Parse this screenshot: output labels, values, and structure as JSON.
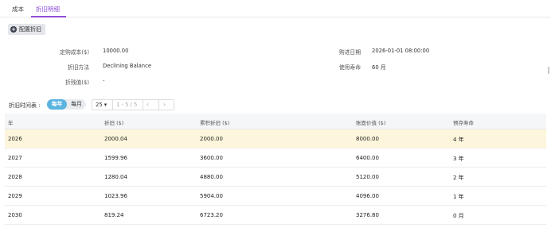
{
  "tabs": [
    {
      "label": "成本"
    },
    {
      "label": "折旧明细"
    }
  ],
  "config_button": {
    "label": "配置折旧",
    "icon": "plus-circle-icon"
  },
  "info": {
    "purchase_cost_label": "定购成本($)",
    "purchase_cost_value": "10000.00",
    "method_label": "折旧方法",
    "method_value": "Declining Balance",
    "residual_label": "折残值($)",
    "residual_value": "-",
    "purchase_date_label": "购进日期",
    "purchase_date_value": "2026-01-01 08:00:00",
    "lifespan_label": "使用寿命",
    "lifespan_value": "60 月"
  },
  "toolbar": {
    "schedule_label": "折旧时间表 :",
    "yearly": "每年",
    "monthly": "每月",
    "page_size": "25 ▾",
    "page_range": "1 - 5 / 5",
    "prev": "‹",
    "next": "›"
  },
  "table": {
    "headers": [
      "年",
      "折旧 ($)",
      "累积折旧 ($)",
      "账面价值 ($)",
      "预存寿命"
    ],
    "rows": [
      [
        "2026",
        "2000.04",
        "2000.00",
        "8000.00",
        "4 年"
      ],
      [
        "2027",
        "1599.96",
        "3600.00",
        "6400.00",
        "3 年"
      ],
      [
        "2028",
        "1280.04",
        "4880.00",
        "5120.00",
        "2 年"
      ],
      [
        "2029",
        "1023.96",
        "5904.00",
        "4096.00",
        "1 年"
      ],
      [
        "2030",
        "819.24",
        "6723.20",
        "3276.80",
        "0 月"
      ]
    ]
  },
  "colors": {
    "accent": "#8e4fd6",
    "toggle_active": "#5ab4e0",
    "selected_row": "#fdf6dc"
  }
}
